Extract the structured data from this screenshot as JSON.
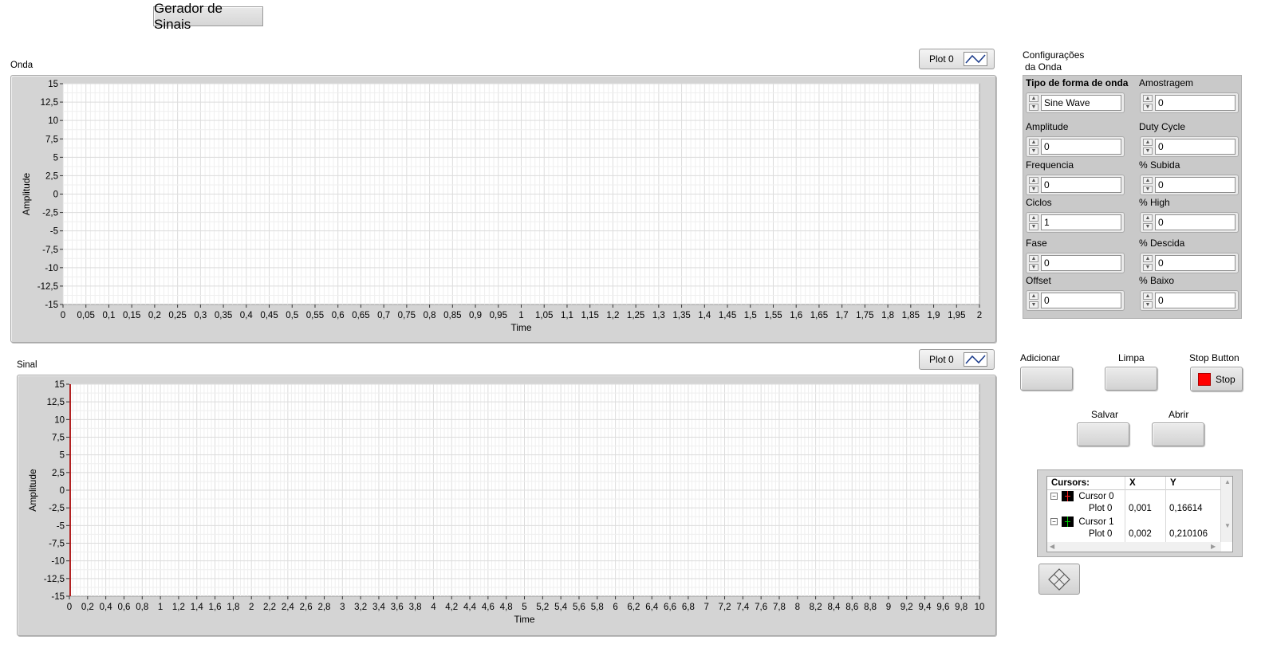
{
  "title_button": "Gerador de Sinais",
  "graph_onda": {
    "label": "Onda",
    "legend": "Plot 0",
    "ylabel": "Amplitude",
    "xlabel": "Time",
    "yticks": [
      "15",
      "12,5",
      "10",
      "7,5",
      "5",
      "2,5",
      "0",
      "-2,5",
      "-5",
      "-7,5",
      "-10",
      "-12,5",
      "-15"
    ],
    "xticks": [
      "0",
      "0,05",
      "0,1",
      "0,15",
      "0,2",
      "0,25",
      "0,3",
      "0,35",
      "0,4",
      "0,45",
      "0,5",
      "0,55",
      "0,6",
      "0,65",
      "0,7",
      "0,75",
      "0,8",
      "0,85",
      "0,9",
      "0,95",
      "1",
      "1,05",
      "1,1",
      "1,15",
      "1,2",
      "1,25",
      "1,3",
      "1,35",
      "1,4",
      "1,45",
      "1,5",
      "1,55",
      "1,6",
      "1,65",
      "1,7",
      "1,75",
      "1,8",
      "1,85",
      "1,9",
      "1,95",
      "2"
    ],
    "plot_color": "#ffffff",
    "grid_color": "#e3e3e3"
  },
  "graph_sinal": {
    "label": "Sinal",
    "legend": "Plot 0",
    "ylabel": "Amplitude",
    "xlabel": "Time",
    "yticks": [
      "15",
      "12,5",
      "10",
      "7,5",
      "5",
      "2,5",
      "0",
      "-2,5",
      "-5",
      "-7,5",
      "-10",
      "-12,5",
      "-15"
    ],
    "xticks": [
      "0",
      "0,2",
      "0,4",
      "0,6",
      "0,8",
      "1",
      "1,2",
      "1,4",
      "1,6",
      "1,8",
      "2",
      "2,2",
      "2,4",
      "2,6",
      "2,8",
      "3",
      "3,2",
      "3,4",
      "3,6",
      "3,8",
      "4",
      "4,2",
      "4,4",
      "4,6",
      "4,8",
      "5",
      "5,2",
      "5,4",
      "5,6",
      "5,8",
      "6",
      "6,2",
      "6,4",
      "6,6",
      "6,8",
      "7",
      "7,2",
      "7,4",
      "7,6",
      "7,8",
      "8",
      "8,2",
      "8,4",
      "8,6",
      "8,8",
      "9",
      "9,2",
      "9,4",
      "9,6",
      "9,8",
      "10"
    ],
    "cursor_line_color": "#b22222"
  },
  "config": {
    "title_line1": "Configurações",
    "title_line2": "da Onda",
    "left_fields": [
      {
        "label": "Tipo de forma de onda",
        "value": "Sine Wave"
      },
      {
        "label": "Amplitude",
        "value": "0"
      },
      {
        "label": "Frequencia",
        "value": "0"
      },
      {
        "label": "Ciclos",
        "value": "1"
      },
      {
        "label": "Fase",
        "value": "0"
      },
      {
        "label": "Offset",
        "value": "0"
      }
    ],
    "right_fields": [
      {
        "label": "Amostragem",
        "value": "0"
      },
      {
        "label": "Duty Cycle",
        "value": "0"
      },
      {
        "label": "% Subida",
        "value": "0"
      },
      {
        "label": "% High",
        "value": "0"
      },
      {
        "label": "% Descida",
        "value": "0"
      },
      {
        "label": "% Baixo",
        "value": "0"
      }
    ]
  },
  "buttons": {
    "adicionar": "Adicionar",
    "limpa": "Limpa",
    "stop_caption": "Stop Button",
    "stop_text": "Stop",
    "salvar": "Salvar",
    "abrir": "Abrir"
  },
  "cursors": {
    "header": [
      "Cursors:",
      "X",
      "Y"
    ],
    "rows": [
      {
        "name": "Cursor 0",
        "plot": "Plot 0",
        "x": "0,001",
        "y": "0,16614",
        "color": "#ff2020"
      },
      {
        "name": "Cursor 1",
        "plot": "Plot 0",
        "x": "0,002",
        "y": "0,210106",
        "color": "#00d000"
      }
    ]
  }
}
